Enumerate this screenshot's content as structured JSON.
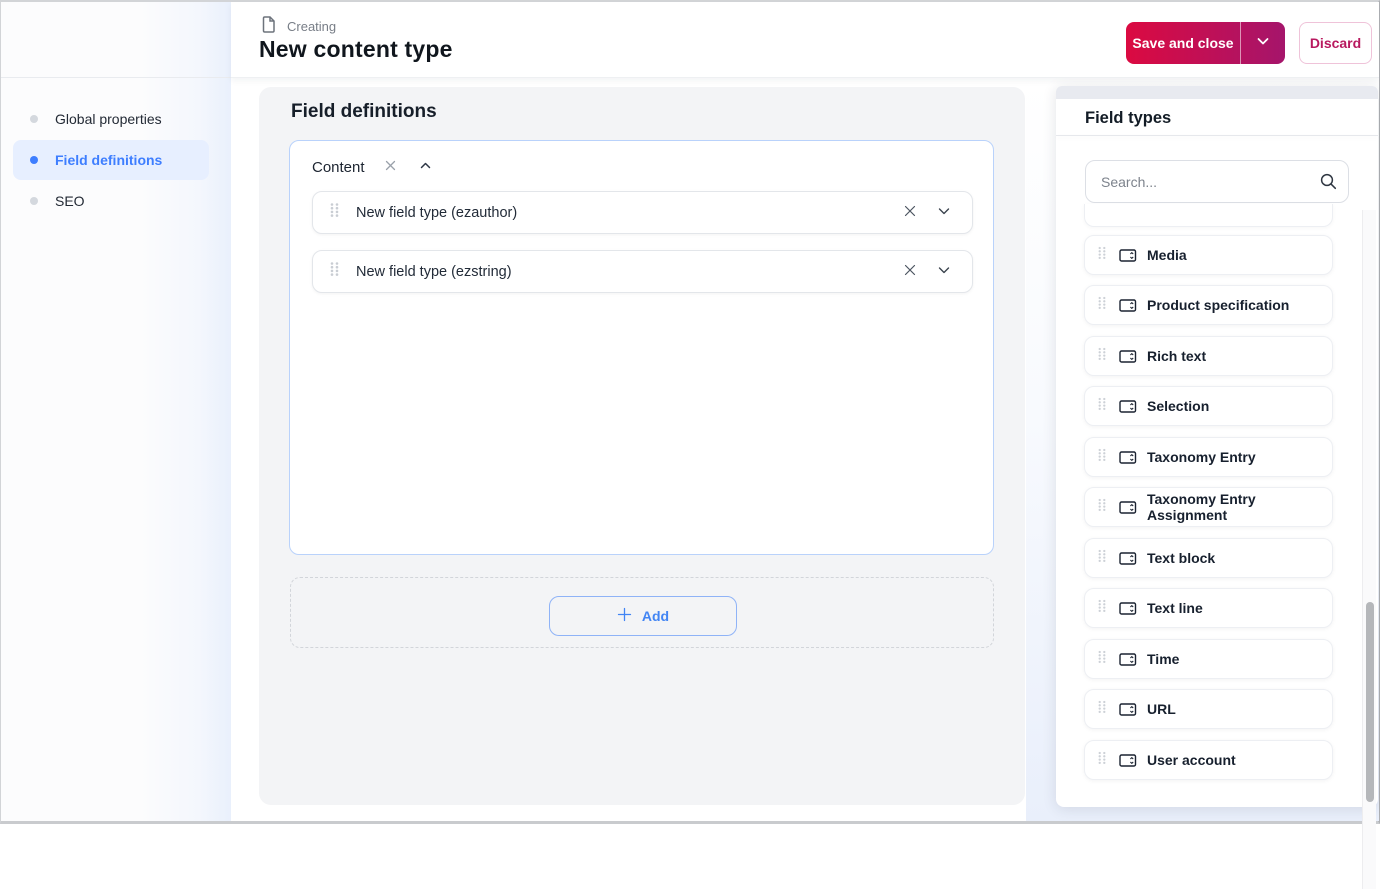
{
  "header": {
    "kicker": "Creating",
    "title": "New content type",
    "save_label": "Save and close",
    "discard_label": "Discard"
  },
  "sidebar": {
    "items": [
      {
        "label": "Global properties",
        "active": false
      },
      {
        "label": "Field definitions",
        "active": true
      },
      {
        "label": "SEO",
        "active": false
      }
    ]
  },
  "main": {
    "section_title": "Field definitions",
    "group": {
      "name": "Content",
      "fields": [
        {
          "label": "New field type (ezauthor)"
        },
        {
          "label": "New field type (ezstring)"
        }
      ]
    },
    "add_label": "Add"
  },
  "field_types_panel": {
    "title": "Field types",
    "search_placeholder": "Search...",
    "items": [
      "Media",
      "Product specification",
      "Rich text",
      "Selection",
      "Taxonomy Entry",
      "Taxonomy Entry Assignment",
      "Text block",
      "Text line",
      "Time",
      "URL",
      "User account"
    ]
  },
  "icons": {
    "document": "document-icon",
    "chevron_down": "chevron-down-icon",
    "chevron_up": "chevron-up-icon",
    "close": "close-icon",
    "plus": "plus-icon",
    "search": "search-icon",
    "drag_handle": "drag-handle-icon",
    "field_type": "field-type-icon",
    "bullet": "bullet-icon"
  },
  "colors": {
    "primary_gradient_start": "#db0a41",
    "primary_gradient_end": "#a5156b",
    "discard_text": "#b8195f",
    "accent_blue": "#3e7eff",
    "selected_bg": "#e7efff",
    "group_border": "#b9d2fb",
    "panel_gray": "#f3f4f6",
    "dark_text": "#131c26"
  }
}
